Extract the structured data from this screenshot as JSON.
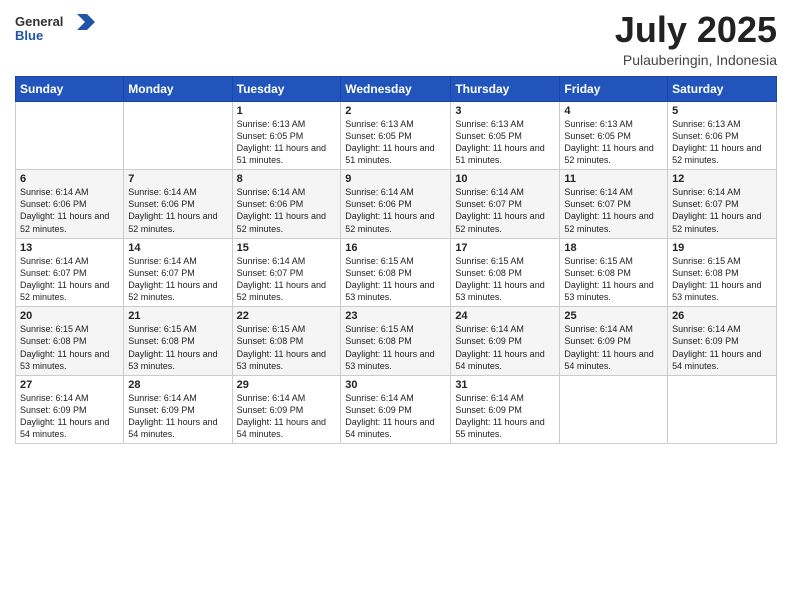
{
  "header": {
    "logo_general": "General",
    "logo_blue": "Blue",
    "title": "July 2025",
    "location": "Pulauberingin, Indonesia"
  },
  "weekdays": [
    "Sunday",
    "Monday",
    "Tuesday",
    "Wednesday",
    "Thursday",
    "Friday",
    "Saturday"
  ],
  "weeks": [
    [
      {
        "day": "",
        "info": ""
      },
      {
        "day": "",
        "info": ""
      },
      {
        "day": "1",
        "info": "Sunrise: 6:13 AM\nSunset: 6:05 PM\nDaylight: 11 hours and 51 minutes."
      },
      {
        "day": "2",
        "info": "Sunrise: 6:13 AM\nSunset: 6:05 PM\nDaylight: 11 hours and 51 minutes."
      },
      {
        "day": "3",
        "info": "Sunrise: 6:13 AM\nSunset: 6:05 PM\nDaylight: 11 hours and 51 minutes."
      },
      {
        "day": "4",
        "info": "Sunrise: 6:13 AM\nSunset: 6:05 PM\nDaylight: 11 hours and 52 minutes."
      },
      {
        "day": "5",
        "info": "Sunrise: 6:13 AM\nSunset: 6:06 PM\nDaylight: 11 hours and 52 minutes."
      }
    ],
    [
      {
        "day": "6",
        "info": "Sunrise: 6:14 AM\nSunset: 6:06 PM\nDaylight: 11 hours and 52 minutes."
      },
      {
        "day": "7",
        "info": "Sunrise: 6:14 AM\nSunset: 6:06 PM\nDaylight: 11 hours and 52 minutes."
      },
      {
        "day": "8",
        "info": "Sunrise: 6:14 AM\nSunset: 6:06 PM\nDaylight: 11 hours and 52 minutes."
      },
      {
        "day": "9",
        "info": "Sunrise: 6:14 AM\nSunset: 6:06 PM\nDaylight: 11 hours and 52 minutes."
      },
      {
        "day": "10",
        "info": "Sunrise: 6:14 AM\nSunset: 6:07 PM\nDaylight: 11 hours and 52 minutes."
      },
      {
        "day": "11",
        "info": "Sunrise: 6:14 AM\nSunset: 6:07 PM\nDaylight: 11 hours and 52 minutes."
      },
      {
        "day": "12",
        "info": "Sunrise: 6:14 AM\nSunset: 6:07 PM\nDaylight: 11 hours and 52 minutes."
      }
    ],
    [
      {
        "day": "13",
        "info": "Sunrise: 6:14 AM\nSunset: 6:07 PM\nDaylight: 11 hours and 52 minutes."
      },
      {
        "day": "14",
        "info": "Sunrise: 6:14 AM\nSunset: 6:07 PM\nDaylight: 11 hours and 52 minutes."
      },
      {
        "day": "15",
        "info": "Sunrise: 6:14 AM\nSunset: 6:07 PM\nDaylight: 11 hours and 52 minutes."
      },
      {
        "day": "16",
        "info": "Sunrise: 6:15 AM\nSunset: 6:08 PM\nDaylight: 11 hours and 53 minutes."
      },
      {
        "day": "17",
        "info": "Sunrise: 6:15 AM\nSunset: 6:08 PM\nDaylight: 11 hours and 53 minutes."
      },
      {
        "day": "18",
        "info": "Sunrise: 6:15 AM\nSunset: 6:08 PM\nDaylight: 11 hours and 53 minutes."
      },
      {
        "day": "19",
        "info": "Sunrise: 6:15 AM\nSunset: 6:08 PM\nDaylight: 11 hours and 53 minutes."
      }
    ],
    [
      {
        "day": "20",
        "info": "Sunrise: 6:15 AM\nSunset: 6:08 PM\nDaylight: 11 hours and 53 minutes."
      },
      {
        "day": "21",
        "info": "Sunrise: 6:15 AM\nSunset: 6:08 PM\nDaylight: 11 hours and 53 minutes."
      },
      {
        "day": "22",
        "info": "Sunrise: 6:15 AM\nSunset: 6:08 PM\nDaylight: 11 hours and 53 minutes."
      },
      {
        "day": "23",
        "info": "Sunrise: 6:15 AM\nSunset: 6:08 PM\nDaylight: 11 hours and 53 minutes."
      },
      {
        "day": "24",
        "info": "Sunrise: 6:14 AM\nSunset: 6:09 PM\nDaylight: 11 hours and 54 minutes."
      },
      {
        "day": "25",
        "info": "Sunrise: 6:14 AM\nSunset: 6:09 PM\nDaylight: 11 hours and 54 minutes."
      },
      {
        "day": "26",
        "info": "Sunrise: 6:14 AM\nSunset: 6:09 PM\nDaylight: 11 hours and 54 minutes."
      }
    ],
    [
      {
        "day": "27",
        "info": "Sunrise: 6:14 AM\nSunset: 6:09 PM\nDaylight: 11 hours and 54 minutes."
      },
      {
        "day": "28",
        "info": "Sunrise: 6:14 AM\nSunset: 6:09 PM\nDaylight: 11 hours and 54 minutes."
      },
      {
        "day": "29",
        "info": "Sunrise: 6:14 AM\nSunset: 6:09 PM\nDaylight: 11 hours and 54 minutes."
      },
      {
        "day": "30",
        "info": "Sunrise: 6:14 AM\nSunset: 6:09 PM\nDaylight: 11 hours and 54 minutes."
      },
      {
        "day": "31",
        "info": "Sunrise: 6:14 AM\nSunset: 6:09 PM\nDaylight: 11 hours and 55 minutes."
      },
      {
        "day": "",
        "info": ""
      },
      {
        "day": "",
        "info": ""
      }
    ]
  ]
}
